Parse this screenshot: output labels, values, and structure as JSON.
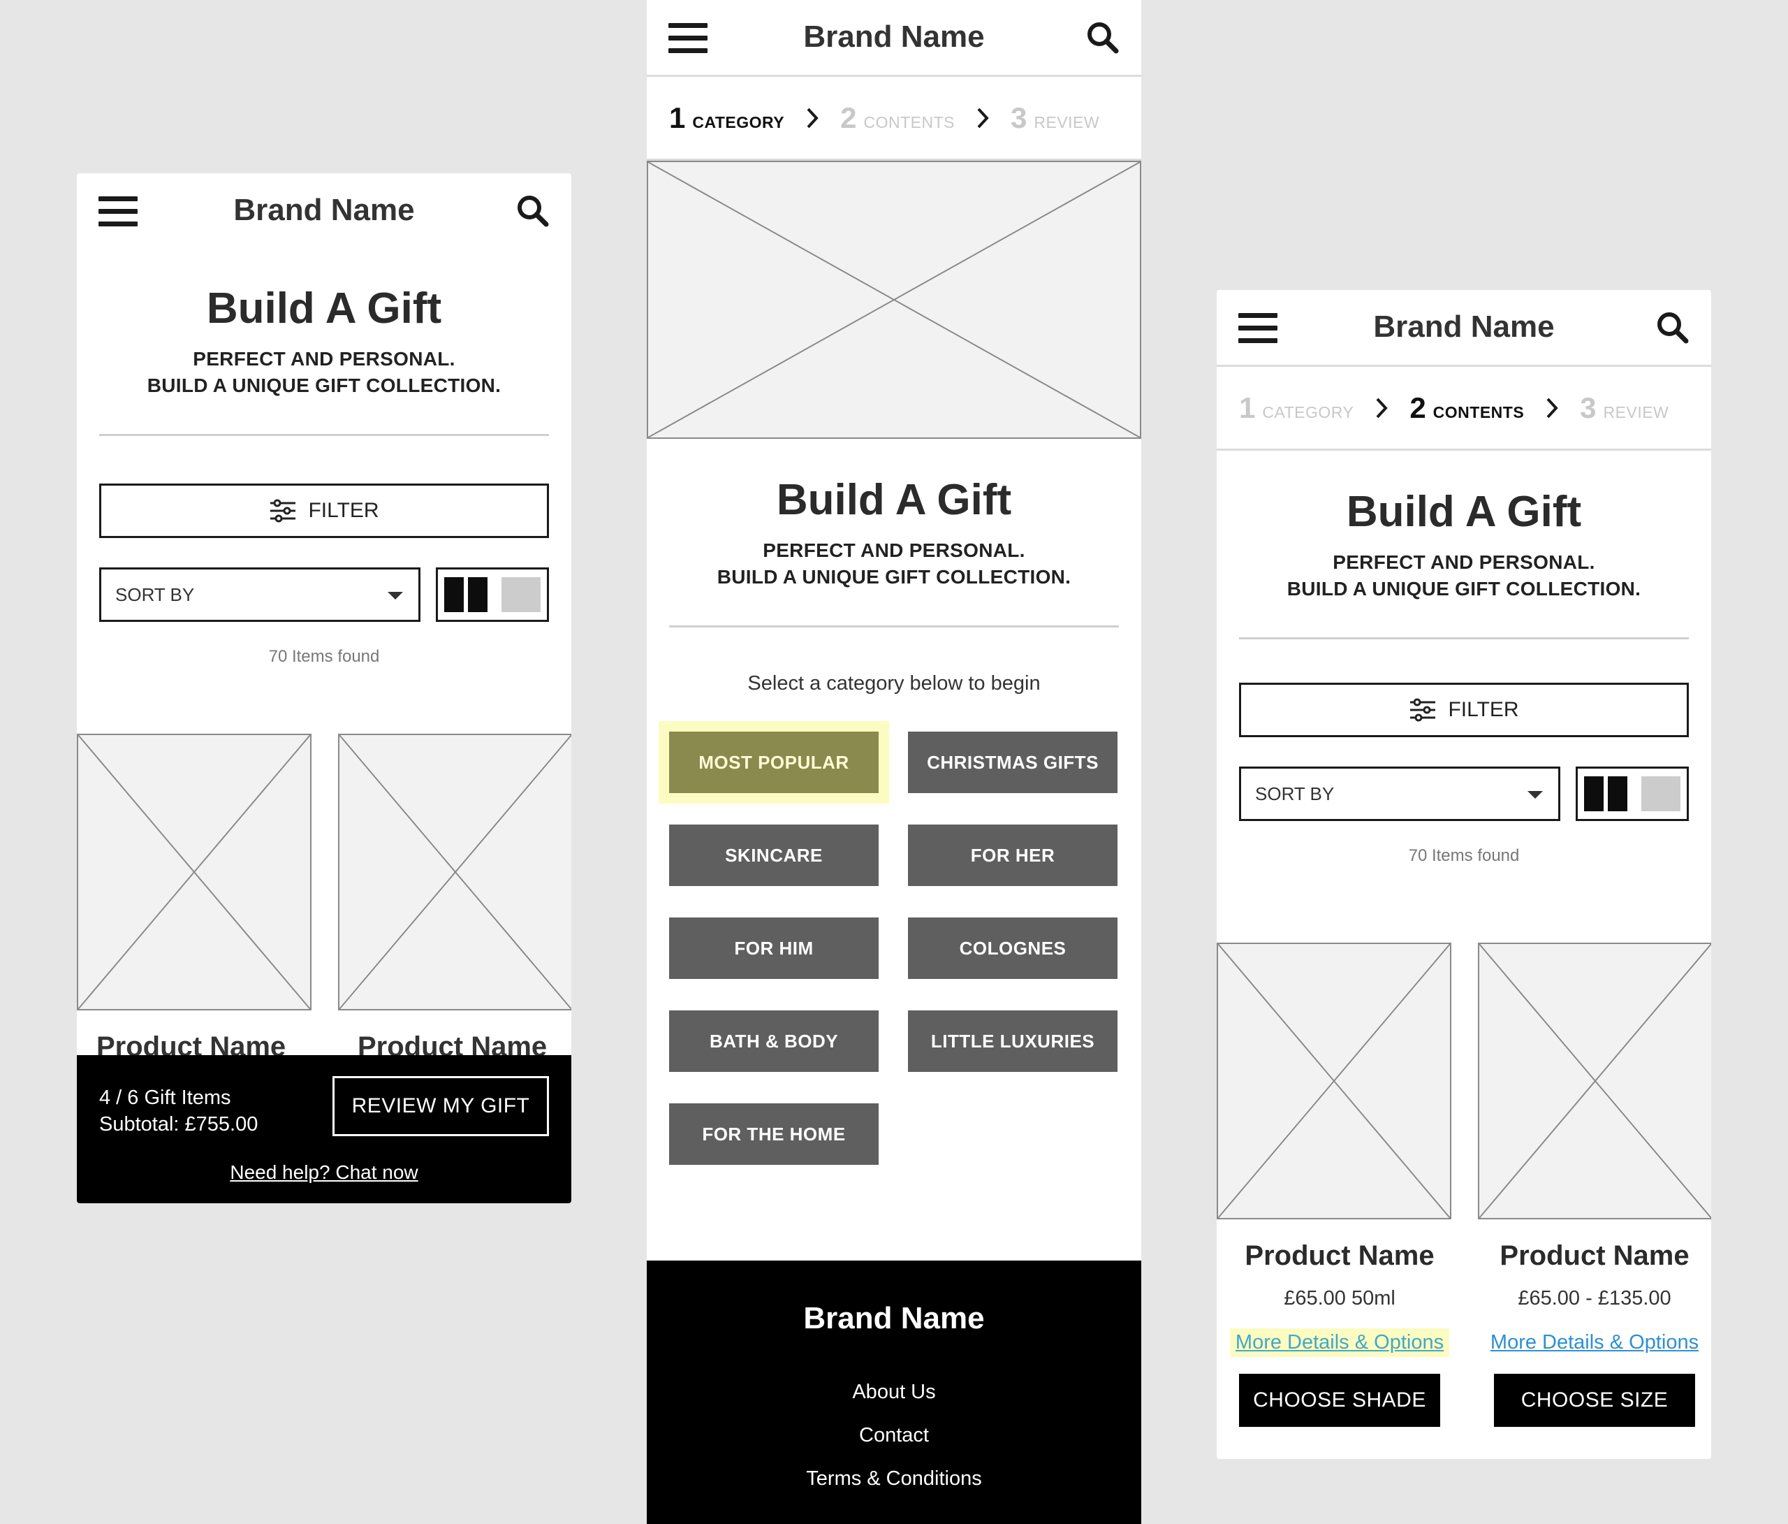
{
  "brand_name": "Brand Name",
  "page_title": "Build A Gift",
  "subtitle_line1": "PERFECT AND PERSONAL.",
  "subtitle_line2": "BUILD A UNIQUE GIFT COLLECTION.",
  "filter_label": "FILTER",
  "sort_label": "SORT BY",
  "items_found": "70 Items found",
  "stepper": [
    {
      "num": "1",
      "label": "CATEGORY"
    },
    {
      "num": "2",
      "label": "CONTENTS"
    },
    {
      "num": "3",
      "label": "REVIEW"
    }
  ],
  "screen_a": {
    "product_names": [
      "Product Name",
      "Product Name"
    ],
    "sticky": {
      "count": "4 / 6 Gift Items",
      "subtotal": "Subtotal: £755.00",
      "review_button": "REVIEW MY GIFT",
      "help_link": "Need help? Chat now"
    }
  },
  "screen_b": {
    "active_step": 1,
    "intro": "Select a category below to begin",
    "categories": [
      "MOST POPULAR",
      "CHRISTMAS GIFTS",
      "SKINCARE",
      "FOR HER",
      "FOR HIM",
      "COLOGNES",
      "BATH & BODY",
      "LITTLE LUXURIES",
      "FOR THE HOME"
    ],
    "highlighted_category": "MOST POPULAR",
    "footer": {
      "brand": "Brand Name",
      "links": [
        "About Us",
        "Contact",
        "Terms & Conditions"
      ]
    }
  },
  "screen_c": {
    "active_step": 2,
    "products": [
      {
        "name": "Product Name",
        "price": "£65.00 50ml",
        "link": "More Details & Options",
        "cta": "CHOOSE SHADE"
      },
      {
        "name": "Product Name",
        "price": "£65.00 - £135.00",
        "link": "More Details & Options",
        "cta": "CHOOSE SIZE"
      }
    ]
  },
  "colors": {
    "background": "#e6e6e6",
    "category_button": "#5f5f5f",
    "highlight": "#fcfcc2",
    "link": "#2f8fd1",
    "black_bar": "#000000"
  },
  "icons": [
    "hamburger-icon",
    "search-icon",
    "filter-sliders-icon",
    "chevron-right-icon",
    "caret-down-icon"
  ]
}
